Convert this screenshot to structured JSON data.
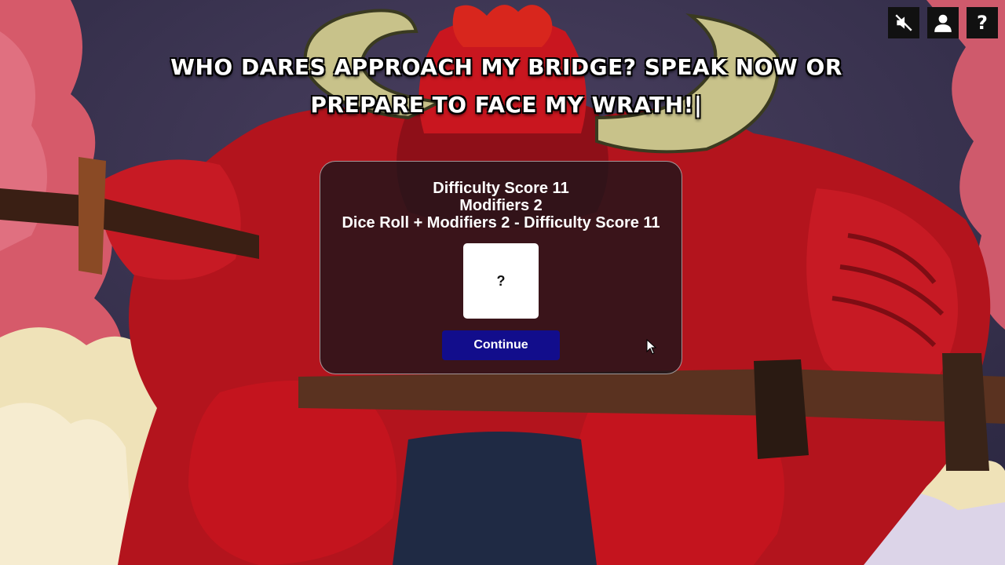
{
  "scene": {
    "background": "troll-on-bridge-illustration",
    "sky_color": "#3b3550",
    "troll_color": "#c4141e"
  },
  "toolbar": {
    "mute_icon": "speaker-muted-icon",
    "profile_icon": "user-icon",
    "help_icon": "help-icon",
    "help_glyph": "?"
  },
  "dialogue": {
    "text": "Who dares approach my bridge? Speak now or prepare to face my wrath!|"
  },
  "roll_panel": {
    "difficulty_line": "Difficulty Score 11",
    "modifiers_line": "Modifiers 2",
    "formula_line": "Dice Roll + Modifiers 2 - Difficulty Score 11",
    "die_value": "?",
    "continue_label": "Continue",
    "continue_color": "#120d8c"
  }
}
